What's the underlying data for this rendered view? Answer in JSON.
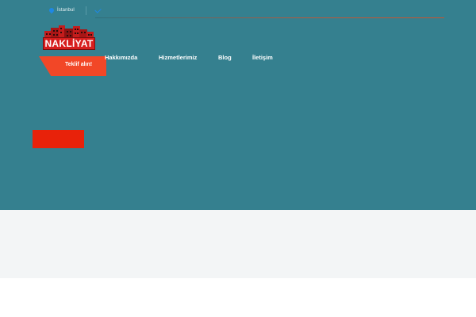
{
  "topbar": {
    "city": "İstanbul",
    "location_icon": "location-pin-icon",
    "check_icon": "check-icon"
  },
  "logo": {
    "text": "NAKLİYAT",
    "art_icon": "buildings-icon"
  },
  "nav": {
    "items": [
      {
        "label": "Hakkımızda"
      },
      {
        "label": "Hizmetlerimiz"
      },
      {
        "label": "Blog"
      },
      {
        "label": "İletişim"
      }
    ]
  },
  "cta": {
    "label": "Teklif alın!"
  },
  "colors": {
    "hero_bg": "#35808f",
    "band_bg": "#f3f5f6",
    "accent": "#f24727",
    "button_red": "#e8220a",
    "logo_red": "#d71e1e",
    "icon_blue": "#1e88e5"
  }
}
